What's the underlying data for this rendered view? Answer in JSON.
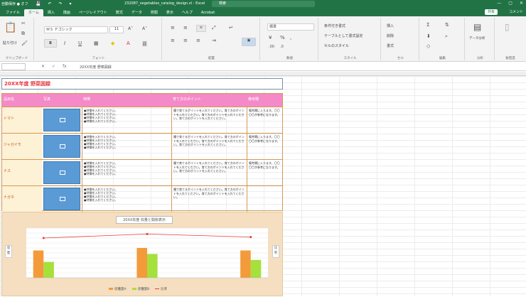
{
  "titlebar": {
    "autosave": "自動保存 ● オフ",
    "document": "232087_vegetables_catalog_design.xl  -  Excel",
    "search": "検索",
    "qat": [
      "💾",
      "↶",
      "↷",
      "▾"
    ],
    "win": [
      "—",
      "▢",
      "✕"
    ]
  },
  "tabs": [
    "ファイル",
    "ホーム",
    "挿入",
    "描画",
    "ページレイアウト",
    "数式",
    "データ",
    "校閲",
    "表示",
    "ヘルプ",
    "Acrobat"
  ],
  "share": "共有",
  "comment": "コメント",
  "ribbon": {
    "clipboard": {
      "label": "クリップボード",
      "paste": "貼り付け"
    },
    "font": {
      "label": "フォント",
      "name": "ＭＳ Ｐゴシック",
      "size": "11"
    },
    "alignment": {
      "label": "配置"
    },
    "number": {
      "label": "数値",
      "format": "標準"
    },
    "styles": {
      "label": "スタイル",
      "items": [
        "条件付き書式",
        "テーブルとして書式設定",
        "セルのスタイル"
      ]
    },
    "cells": {
      "label": "セル",
      "items": [
        "挿入",
        "削除",
        "書式"
      ]
    },
    "editing": {
      "label": "編集"
    },
    "data_analysis": {
      "label": "分析",
      "btn": "データ分析"
    },
    "sensitivity": {
      "label": "秘密度"
    }
  },
  "formula_bar": {
    "name_box": "",
    "value": "20XX年度 野菜図録"
  },
  "sheet": {
    "title": "20XX年度 野菜図録",
    "headers": [
      "品目名",
      "写真",
      "特徴",
      "育て方のポイント",
      "備考欄"
    ],
    "rows": [
      {
        "name": "トマト",
        "features": [
          "●特徴を入れてください。",
          "●特徴を入れてください。",
          "●特徴を入れてください。",
          "●特徴を入れてください。"
        ],
        "points": "種で育てるポイントを入れてください。育て方のポイントを入れてください。育て方のポイントを入れてください。育て方のポイントを入れてください。",
        "note": "備考欄に入ります。〇〇〇〇が参考になります。"
      },
      {
        "name": "ジャガイモ",
        "features": [
          "●特徴を入れてください。",
          "●特徴を入れてください。",
          "●特徴を入れてください。",
          "●特徴を入れてください。"
        ],
        "points": "種で育てるポイントを入れてください。育て方のポイントを入れてください。育て方のポイントを入れてください。育て方のポイントを入れてください。",
        "note": "備考欄に入ります。〇〇〇〇が参考になります。"
      },
      {
        "name": "ナス",
        "features": [
          "●特徴を入れてください。",
          "●特徴を入れてください。",
          "●特徴を入れてください。",
          "●特徴を入れてください。"
        ],
        "points": "種で育てるポイントを入れてください。育て方のポイントを入れてください。育て方のポイントを入れてください。育て方のポイントを入れてください。",
        "note": "備考欄に入ります。〇〇〇〇が参考になります。"
      },
      {
        "name": "ナガネ",
        "features": [
          "●特徴を入れてください。",
          "●特徴を入れてください。",
          "●特徴を入れてください。",
          "●特徴を入れてください。"
        ],
        "points": "種で育てるポイントを入れてください。育て方のポイントを入れてください。育て方のポイントを入れてください。",
        "note": ""
      }
    ]
  },
  "chart_data": {
    "type": "bar",
    "title": "20XX年度 収量と関係表示",
    "categories": [
      "",
      "",
      "",
      "",
      "",
      "",
      ""
    ],
    "series": [
      {
        "name": "収穫量A",
        "type": "bar",
        "color": "#f39b3b",
        "values": [
          55,
          0,
          0,
          60,
          0,
          0,
          55
        ]
      },
      {
        "name": "収穫量B",
        "type": "bar",
        "color": "#a5e03c",
        "values": [
          32,
          0,
          0,
          48,
          0,
          0,
          36
        ]
      },
      {
        "name": "比率",
        "type": "line",
        "color": "#e83b3b",
        "values": [
          80,
          null,
          null,
          88,
          null,
          null,
          82
        ]
      }
    ],
    "ylim": [
      0,
      100
    ],
    "ylabel_left": "収量",
    "ylabel_right": "比率",
    "grid": true,
    "legend": "bottom"
  }
}
